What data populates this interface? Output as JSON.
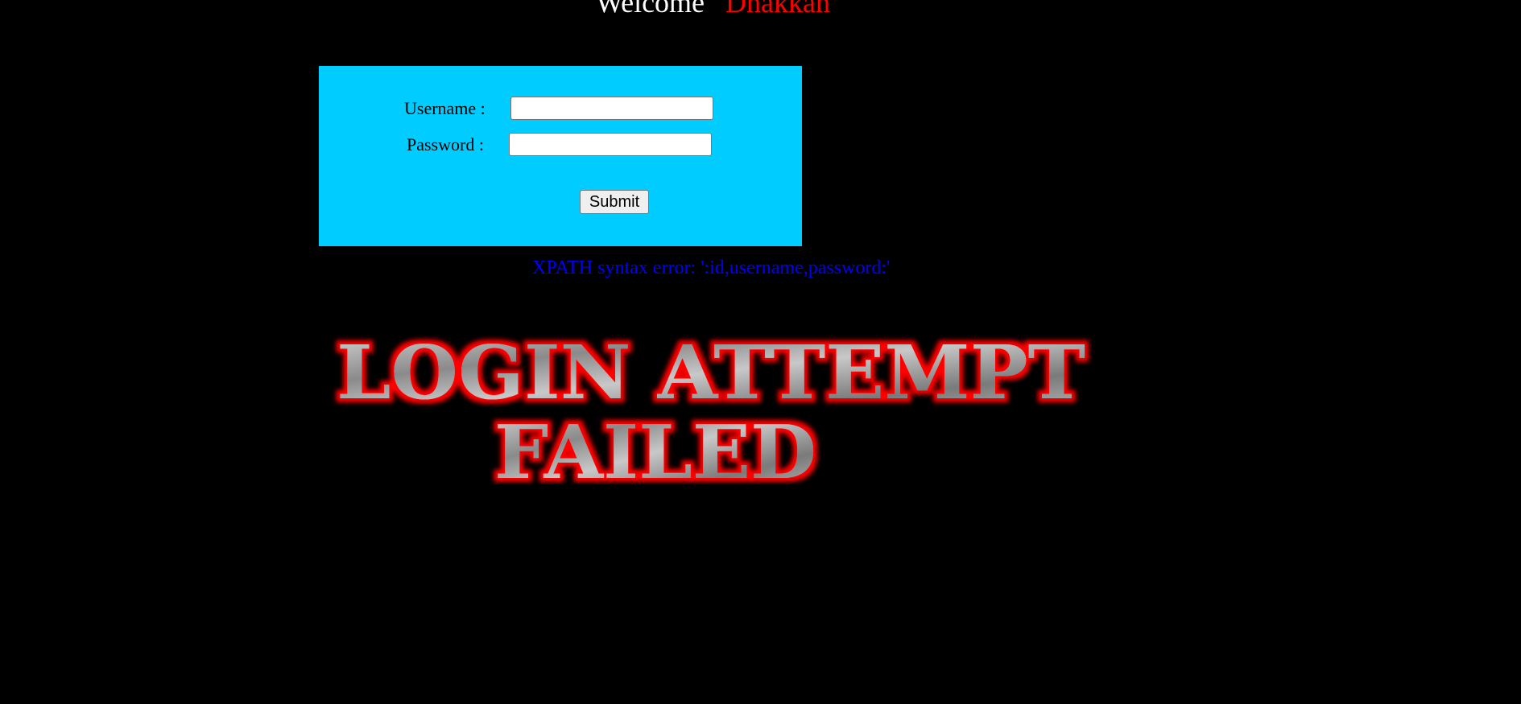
{
  "header": {
    "welcome": "Welcome",
    "name": "Dhakkan"
  },
  "form": {
    "username_label": "Username :",
    "username_value": "",
    "password_label": "Password :",
    "password_value": "",
    "submit_label": "Submit"
  },
  "error": "XPATH syntax error: ':id,username,password:'",
  "banner": {
    "line1": "LOGIN ATTEMPT",
    "line2": "FAILED"
  },
  "colors": {
    "form_bg": "#00ccff",
    "error": "#0000ff",
    "name": "#ff0000"
  }
}
